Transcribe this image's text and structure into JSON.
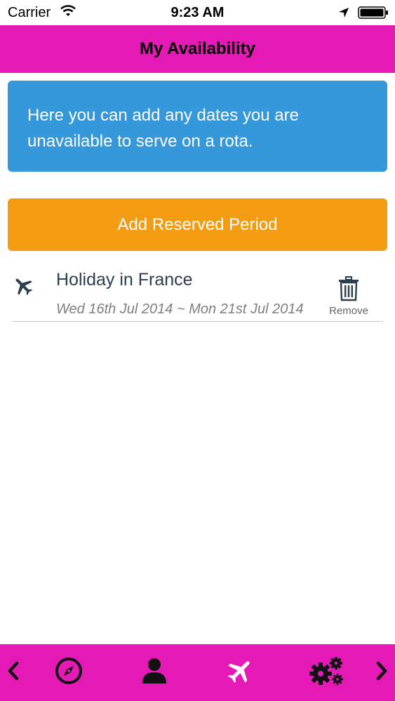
{
  "status_bar": {
    "carrier": "Carrier",
    "time": "9:23 AM"
  },
  "nav": {
    "title": "My Availability"
  },
  "info": {
    "text": "Here you can add any dates you are unavailable to serve on a rota."
  },
  "add_button": {
    "label": "Add Reserved Period"
  },
  "reserved_periods": [
    {
      "title": "Holiday in France",
      "dates": "Wed 16th Jul 2014 ~ Mon 21st Jul 2014",
      "remove_label": "Remove"
    }
  ],
  "tab_bar": {
    "items": [
      "chevron-left-icon",
      "compass-icon",
      "person-icon",
      "airplane-icon",
      "gears-icon",
      "chevron-right-icon"
    ]
  },
  "colors": {
    "brand": "#e419b6",
    "info_bg": "#3498db",
    "accent_button": "#f39c12",
    "icon_dark": "#2c3e50"
  }
}
